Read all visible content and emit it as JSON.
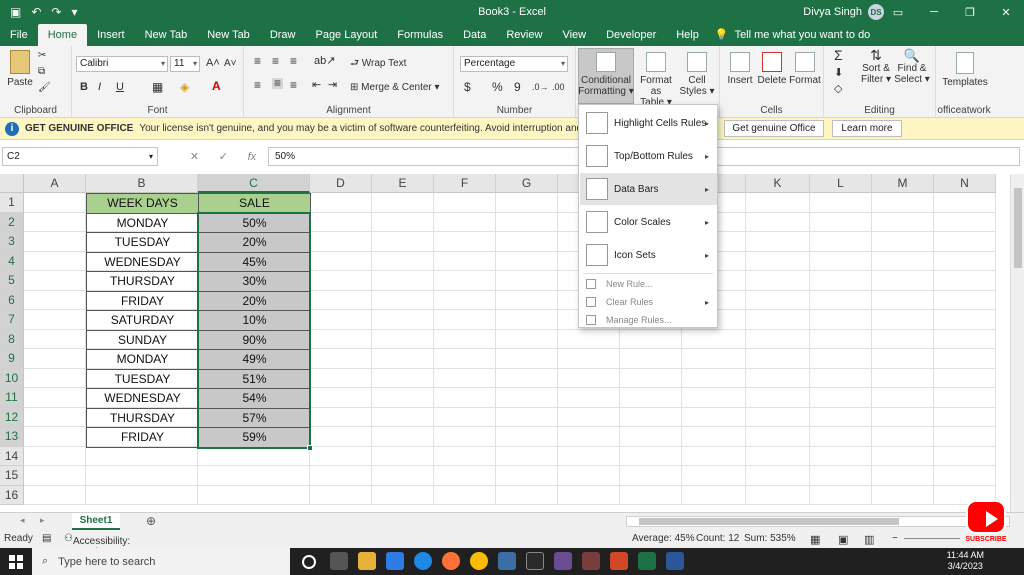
{
  "window": {
    "title": "Book3  -  Excel",
    "user": "Divya Singh",
    "avatar_initials": "DS"
  },
  "tabs": [
    {
      "label": "File"
    },
    {
      "label": "Home"
    },
    {
      "label": "Insert"
    },
    {
      "label": "New Tab"
    },
    {
      "label": "New Tab"
    },
    {
      "label": "Draw"
    },
    {
      "label": "Page Layout"
    },
    {
      "label": "Formulas"
    },
    {
      "label": "Data"
    },
    {
      "label": "Review"
    },
    {
      "label": "View"
    },
    {
      "label": "Developer"
    },
    {
      "label": "Help"
    }
  ],
  "tell_me": "Tell me what you want to do",
  "ribbon": {
    "clipboard": {
      "paste": "Paste",
      "label": "Clipboard"
    },
    "font": {
      "name": "Calibri",
      "size": "11",
      "label": "Font",
      "bold": "B",
      "italic": "I",
      "underline": "U"
    },
    "alignment": {
      "wrap": "Wrap Text",
      "merge": "Merge & Center",
      "label": "Alignment"
    },
    "number": {
      "format": "Percentage",
      "currency": "$",
      "percent": "%",
      "comma": "9",
      "label": "Number"
    },
    "styles": {
      "cond1": "Conditional",
      "cond2": "Formatting",
      "fat1": "Format as",
      "fat2": "Table",
      "cs1": "Cell",
      "cs2": "Styles"
    },
    "cells": {
      "insert": "Insert",
      "delete": "Delete",
      "format": "Format",
      "label": "Cells"
    },
    "editing": {
      "sort1": "Sort &",
      "sort2": "Filter",
      "find1": "Find &",
      "find2": "Select",
      "label": "Editing"
    },
    "templates": {
      "btn": "Templates",
      "label": "officeatwork"
    }
  },
  "infobar": {
    "title": "GET GENUINE OFFICE",
    "message": "Your license isn't genuine, and you may be a victim of software counterfeiting. Avoid interruption and keep your file",
    "btn1": "Get genuine Office",
    "btn2": "Learn more"
  },
  "formula_bar": {
    "namebox": "C2",
    "formula": "50%",
    "fx": "fx"
  },
  "columns": [
    "A",
    "B",
    "C",
    "D",
    "E",
    "F",
    "G",
    "H",
    "I",
    "J",
    "K",
    "L",
    "M",
    "N"
  ],
  "rows": [
    "1",
    "2",
    "3",
    "4",
    "5",
    "6",
    "7",
    "8",
    "9",
    "10",
    "11",
    "12",
    "13",
    "14",
    "15",
    "16"
  ],
  "table": {
    "header_b": "WEEK DAYS",
    "header_c": "SALE",
    "rows": [
      {
        "day": "MONDAY",
        "sale": "50%"
      },
      {
        "day": "TUESDAY",
        "sale": "20%"
      },
      {
        "day": "WEDNESDAY",
        "sale": "45%"
      },
      {
        "day": "THURSDAY",
        "sale": "30%"
      },
      {
        "day": "FRIDAY",
        "sale": "20%"
      },
      {
        "day": "SATURDAY",
        "sale": "10%"
      },
      {
        "day": "SUNDAY",
        "sale": "90%"
      },
      {
        "day": "MONDAY",
        "sale": "49%"
      },
      {
        "day": "TUESDAY",
        "sale": "51%"
      },
      {
        "day": "WEDNESDAY",
        "sale": "54%"
      },
      {
        "day": "THURSDAY",
        "sale": "57%"
      },
      {
        "day": "FRIDAY",
        "sale": "59%"
      }
    ]
  },
  "cf_menu": {
    "highlight": "Highlight Cells Rules",
    "topbottom": "Top/Bottom Rules",
    "databars": "Data Bars",
    "colorscales": "Color Scales",
    "iconsets": "Icon Sets",
    "newrule": "New Rule...",
    "clearrules": "Clear Rules",
    "managerules": "Manage Rules..."
  },
  "sheet": {
    "name": "Sheet1"
  },
  "status": {
    "ready": "Ready",
    "accessibility": "Accessibility: Good to go",
    "average": "Average: 45%",
    "count": "Count: 12",
    "sum": "Sum: 535%"
  },
  "taskbar": {
    "search": "Type here to search",
    "time": "11:44 AM",
    "date": "3/4/2023"
  },
  "watermark": {
    "label": "SUBSCRIBE"
  },
  "colors": {
    "excel_green": "#1e7145",
    "header_fill": "#a9d08e",
    "sale_fill": "#c8c8c8"
  }
}
